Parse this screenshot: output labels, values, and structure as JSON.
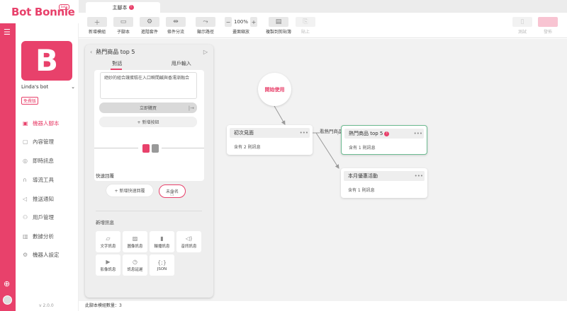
{
  "brand": {
    "logo_text": "Bot Bonnie",
    "logo_badge": "beta"
  },
  "tabs": [
    {
      "label": "主腳本"
    }
  ],
  "toolbar": {
    "new_module": "新增模組",
    "sub_script": "子腳本",
    "advanced": "進階套件",
    "condition": "條件分流",
    "show_path": "顯示路徑",
    "zoom_label": "畫面縮放",
    "zoom_value": "100%",
    "copy_clipboard": "複製到剪貼簿",
    "paste": "貼上",
    "test": "測試",
    "publish": "發佈"
  },
  "sidebar": {
    "bot_name": "Linda's bot",
    "plan": "免費版",
    "version": "v 2.0.0",
    "items": [
      {
        "label": "機器人腳本"
      },
      {
        "label": "內容管理"
      },
      {
        "label": "即時訊息"
      },
      {
        "label": "導流工具"
      },
      {
        "label": "推送通知"
      },
      {
        "label": "用戶管理"
      },
      {
        "label": "數據分析"
      },
      {
        "label": "機器人設定"
      }
    ]
  },
  "editor": {
    "title": "熱門商品 top 5",
    "tab_dialog": "對話",
    "tab_user_input": "用戶輸入",
    "description": "絕妙的組合讓蛋糕在入口瞬間鹹與香濡漸融合",
    "buy_button": "立即購買",
    "add_button": "+ 新增按鈕",
    "quick_reply_title": "快速回覆",
    "add_quick_reply": "+ 新增快速回覆",
    "unnamed_reply": "未命名",
    "new_message_title": "新增訊息",
    "message_types": [
      "文字訊息",
      "圖像訊息",
      "輪播訊息",
      "音訊訊息",
      "影像訊息",
      "訊息延遲",
      "JSON"
    ]
  },
  "flow": {
    "start": "開始使用",
    "nodes": [
      {
        "title": "初次見面",
        "subtitle": "含有 2 則訊息"
      },
      {
        "title": "熱門商品 top 5",
        "subtitle": "含有 1 則訊息"
      },
      {
        "title": "本月優惠活動",
        "subtitle": "含有 1 則訊息"
      }
    ],
    "edge_label": "看熱門商品"
  },
  "status": "此腳本模組數量：3",
  "colors": {
    "brand": "#e8416b",
    "selected_border": "#6dbb91"
  }
}
